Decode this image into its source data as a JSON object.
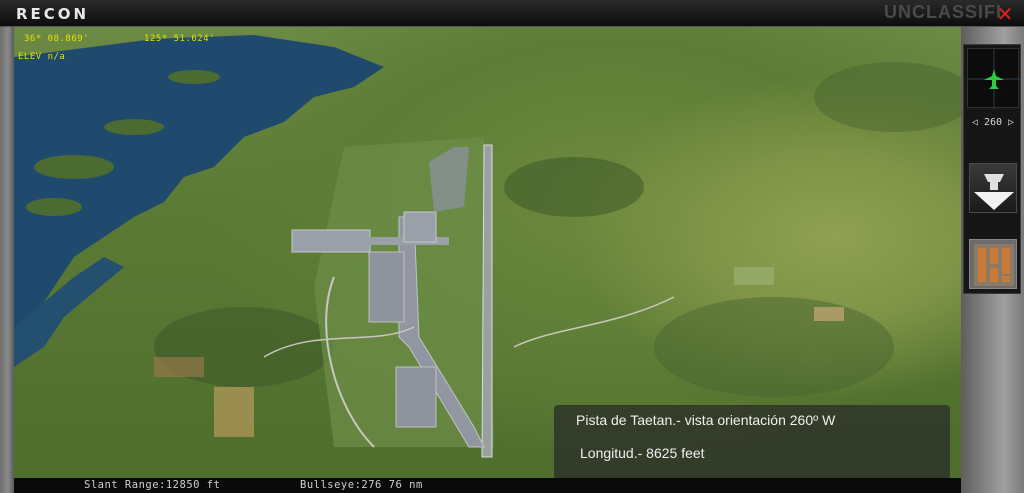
{
  "window": {
    "title": "RECON",
    "classification": "UNCLASSIFIED",
    "classification_visible": "UNCLASSIFI",
    "close_icon": "close-icon"
  },
  "hud": {
    "latitude": "36* 08.869'",
    "longitude": "125* 51.624'",
    "elevation": "ELEV n/a"
  },
  "caption": {
    "line1": "Pista de Taetan.- vista orientación  260º  W",
    "line2": "Longitud.- 8625 feet"
  },
  "right_panel": {
    "heading": "◁ 260 ▷",
    "compass_icon": "aircraft-compass-icon",
    "direction_icon": "look-direction-icon",
    "map_icon": "map-icon"
  },
  "status": {
    "slant_range": "Slant Range:12850 ft",
    "bullseye": "Bullseye:276  76 nm"
  },
  "colors": {
    "hud_text": "#e6e000",
    "close": "#e02020",
    "water": "#1f4a6e",
    "terrain": "#5b7a35"
  }
}
